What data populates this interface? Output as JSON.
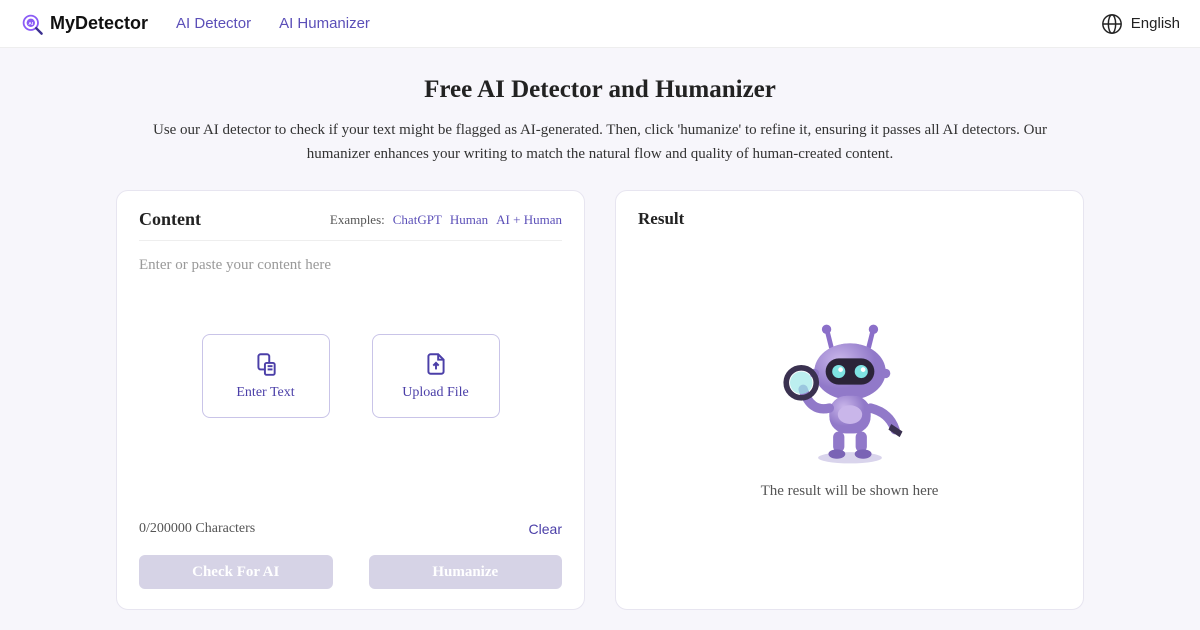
{
  "header": {
    "brand": "MyDetector",
    "nav": {
      "detector": "AI Detector",
      "humanizer": "AI Humanizer"
    },
    "language": "English"
  },
  "hero": {
    "title": "Free AI Detector and Humanizer",
    "subtitle": "Use our AI detector to check if your text might be flagged as AI-generated. Then, click 'humanize' to refine it, ensuring it passes all AI detectors. Our humanizer enhances your writing to match the natural flow and quality of human-created content."
  },
  "content_card": {
    "title": "Content",
    "examples_label": "Examples:",
    "examples": {
      "chatgpt": "ChatGPT",
      "human": "Human",
      "ai_human": "AI + Human"
    },
    "placeholder": "Enter or paste your content here",
    "options": {
      "enter_text": "Enter Text",
      "upload_file": "Upload File"
    },
    "counter": "0/200000 Characters",
    "clear": "Clear",
    "buttons": {
      "check": "Check For AI",
      "humanize": "Humanize"
    }
  },
  "result_card": {
    "title": "Result",
    "empty_message": "The result will be shown here"
  }
}
